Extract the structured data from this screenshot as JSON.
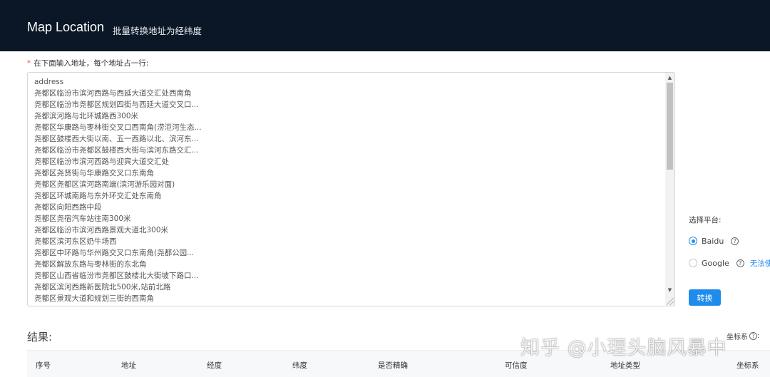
{
  "header": {
    "title": "Map Location",
    "subtitle": "批量转换地址为经纬度"
  },
  "input": {
    "required_mark": "*",
    "label": "在下面输入地址，每个地址占一行:",
    "lines": [
      "address",
      "尧都区临汾市滨河西路与西延大道交汇处西南角",
      "尧都区临汾市尧都区规划四街与西延大道交叉口...",
      "尧都滨河路与北环城路西300米",
      "尧都区华康路与枣林街交叉口西南角(涝洰河生态...",
      "尧都区鼓楼西大街以南、五一西路以北、滨河东...",
      "尧都区临汾市尧都区鼓楼西大街与滨河东路交汇...",
      "尧都区临汾市滨河西路与迎宾大道交汇处",
      "尧都区尧贤街与华康路交叉口东南角",
      "尧都区尧都区滨河路南端(滨河游乐园对面)",
      "尧都区环城南路与东外环交汇处东南角",
      "尧都区向阳西路中段",
      "尧都区尧宿汽车站往南300米",
      "尧都区临汾市滨河西路景观大道北300米",
      "尧都区滨河东区奶牛场西",
      "尧都区中环路与华州路交叉口东南角(尧都公园...",
      "尧都区解放东路与枣林街的东北角",
      "尧都区山西省临汾市尧都区鼓楼北大街坡下路口...",
      "尧都区滨河西路新医院北500米,站前北路",
      "尧都区景观大道和规划三街的西南角"
    ]
  },
  "platform": {
    "label": "选择平台:",
    "options": [
      {
        "label": "Baidu",
        "selected": true
      },
      {
        "label": "Google",
        "selected": false
      }
    ],
    "google_note": "无法使用"
  },
  "convert_button": "转换",
  "results": {
    "title": "结果:",
    "coord_label": "坐标系"
  },
  "table": {
    "columns": [
      "序号",
      "地址",
      "经度",
      "纬度",
      "是否精确",
      "可信度",
      "地址类型",
      "坐标系"
    ]
  },
  "watermark": "知乎 @小理头脑风暴中",
  "colors": {
    "header_bg": "#0b1726",
    "accent": "#1f8ceb",
    "required": "#e34a4a"
  }
}
